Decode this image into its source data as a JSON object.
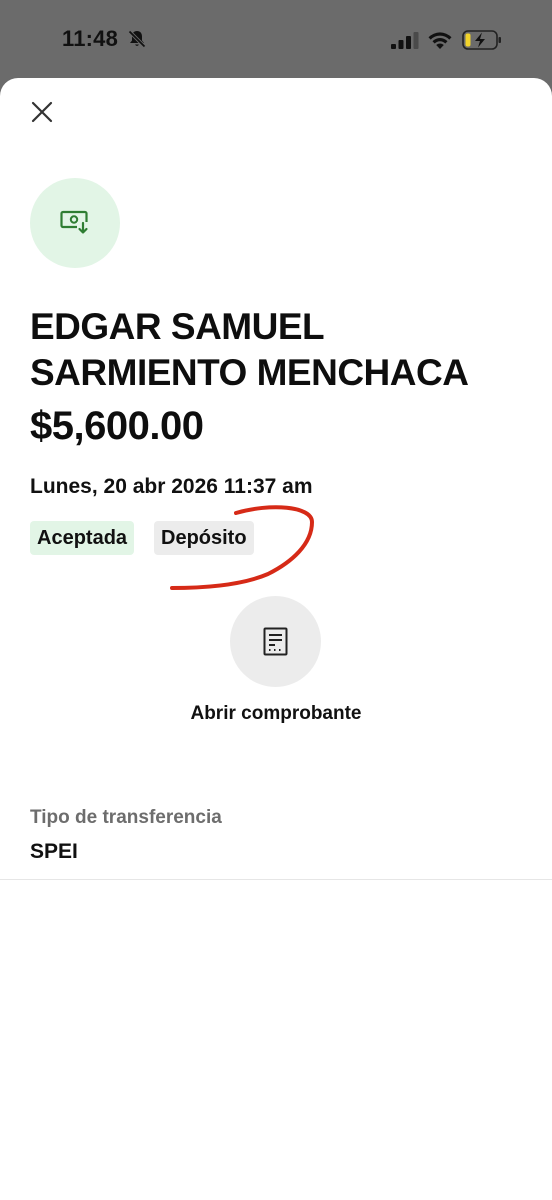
{
  "status_bar": {
    "time": "11:48"
  },
  "icons": {
    "close": "close-icon",
    "transaction": "money-deposit-icon",
    "receipt": "receipt-icon"
  },
  "colors": {
    "accent_green": "#2e7d32",
    "badge_green_bg": "#e2f5e6",
    "badge_gray_bg": "#ececec",
    "annotation_red": "#d62a17"
  },
  "transaction": {
    "name": "EDGAR SAMUEL SARMIENTO MENCHACA",
    "amount": "$5,600.00",
    "datetime": "Lunes, 20 abr 2026 11:37 am",
    "status": "Aceptada",
    "type": "Depósito"
  },
  "actions": {
    "open_receipt": "Abrir comprobante"
  },
  "details": [
    {
      "label": "Tipo de transferencia",
      "value": "SPEI"
    }
  ]
}
